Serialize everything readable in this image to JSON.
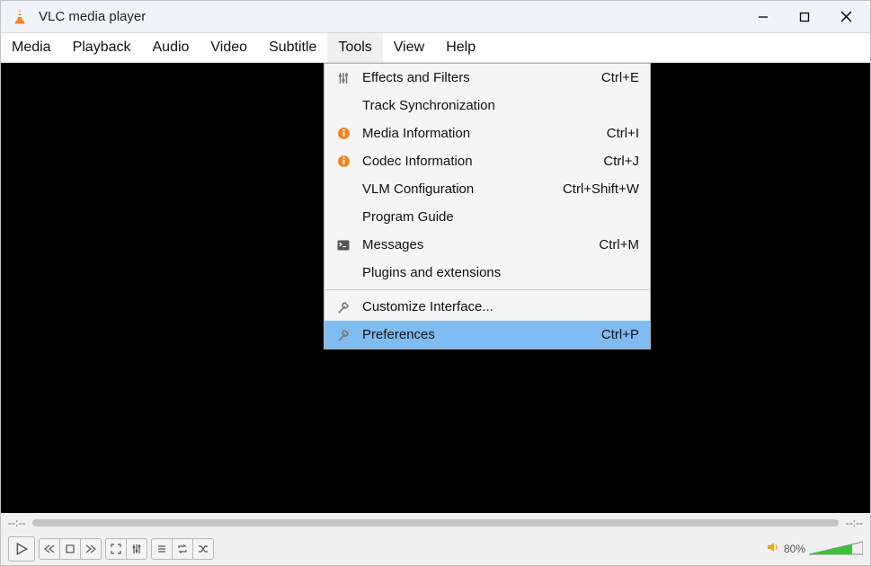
{
  "window": {
    "title": "VLC media player"
  },
  "menubar": [
    "Media",
    "Playback",
    "Audio",
    "Video",
    "Subtitle",
    "Tools",
    "View",
    "Help"
  ],
  "open_menu_index": 5,
  "dropdown": {
    "items": [
      {
        "icon": "sliders",
        "label": "Effects and Filters",
        "shortcut": "Ctrl+E"
      },
      {
        "icon": "",
        "label": "Track Synchronization",
        "shortcut": ""
      },
      {
        "icon": "info",
        "label": "Media Information",
        "shortcut": "Ctrl+I"
      },
      {
        "icon": "info",
        "label": "Codec Information",
        "shortcut": "Ctrl+J"
      },
      {
        "icon": "",
        "label": "VLM Configuration",
        "shortcut": "Ctrl+Shift+W"
      },
      {
        "icon": "",
        "label": "Program Guide",
        "shortcut": ""
      },
      {
        "icon": "terminal",
        "label": "Messages",
        "shortcut": "Ctrl+M"
      },
      {
        "icon": "",
        "label": "Plugins and extensions",
        "shortcut": ""
      },
      {
        "sep": true
      },
      {
        "icon": "wrench",
        "label": "Customize Interface...",
        "shortcut": ""
      },
      {
        "icon": "wrench",
        "label": "Preferences",
        "shortcut": "Ctrl+P",
        "selected": true
      }
    ]
  },
  "seekbar": {
    "elapsed": "--:--",
    "remaining": "--:--"
  },
  "volume": {
    "percent_label": "80%",
    "value": 80
  }
}
